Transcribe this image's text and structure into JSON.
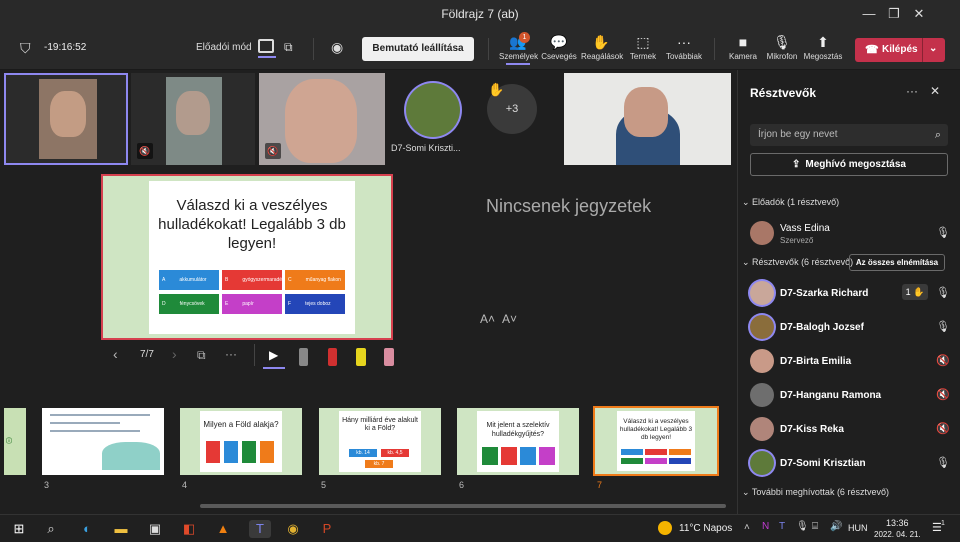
{
  "window": {
    "title": "Földrajz 7 (ab)"
  },
  "toolbar": {
    "timer": "-19:16:52",
    "presenter_mode": "Előadói mód",
    "stop_presenting": "Bemutató leállítása",
    "people": "Személyek",
    "people_badge": "1",
    "chat": "Csevegés",
    "reactions": "Reagálások",
    "rooms": "Termek",
    "more": "Továbbiak",
    "camera": "Kamera",
    "mic": "Mikrofon",
    "share": "Megosztás",
    "leave": "Kilépés"
  },
  "tiles": {
    "somi_label": "D7-Somi Kriszti...",
    "overflow": "+3"
  },
  "slide": {
    "title": "Válaszd ki a veszélyes hulladékokat! Legalább 3 db legyen!",
    "answers": [
      {
        "letter": "A",
        "text": "akkumulátor",
        "color": "#2b8ad8"
      },
      {
        "letter": "B",
        "text": "gyógyszermaradék",
        "color": "#e53935"
      },
      {
        "letter": "C",
        "text": "műanyag flakon",
        "color": "#ef7b1a"
      },
      {
        "letter": "D",
        "text": "fénycsövek",
        "color": "#1f8a3a"
      },
      {
        "letter": "E",
        "text": "papír",
        "color": "#c43fc8"
      },
      {
        "letter": "F",
        "text": "tejes doboz",
        "color": "#2446b8"
      }
    ],
    "counter": "7/7",
    "notes": "Nincsenek jegyzetek",
    "font_up": "A˄",
    "font_down": "A˅"
  },
  "thumbs": [
    {
      "num": "3",
      "title": ""
    },
    {
      "num": "4",
      "title": "Milyen a Föld alakja?"
    },
    {
      "num": "5",
      "title": "Hány milliárd éve alakult ki a Föld?"
    },
    {
      "num": "6",
      "title": "Mit jelent a szelektív hulladékgyűjtés?"
    },
    {
      "num": "7",
      "title": "Válaszd ki a veszélyes hulladékokat! Legalább 3 db legyen!"
    }
  ],
  "thumb5": {
    "a": "kb. 14",
    "b": "kb. 4,5",
    "c": "kb. 7"
  },
  "panel": {
    "title": "Résztvevők",
    "search_placeholder": "Írjon be egy nevet",
    "invite": "Meghívó megosztása",
    "presenters": "Előadók (1 résztvevő)",
    "attendees": "Résztvevők (6 résztvevő)",
    "mute_all": "Az összes elnémítása",
    "invited": "További meghívottak (6 résztvevő)",
    "presenter": {
      "name": "Vass Edina",
      "role": "Szervező"
    },
    "people": [
      {
        "name": "D7-Szarka Richard",
        "hand": "1"
      },
      {
        "name": "D7-Balogh Jozsef"
      },
      {
        "name": "D7-Birta Emilia"
      },
      {
        "name": "D7-Hanganu Ramona"
      },
      {
        "name": "D7-Kiss Reka"
      },
      {
        "name": "D7-Somi Krisztian"
      }
    ]
  },
  "taskbar": {
    "weather": "11°C  Napos",
    "lang": "HUN",
    "time": "13:36",
    "date": "2022. 04. 21.",
    "notif": "1"
  }
}
